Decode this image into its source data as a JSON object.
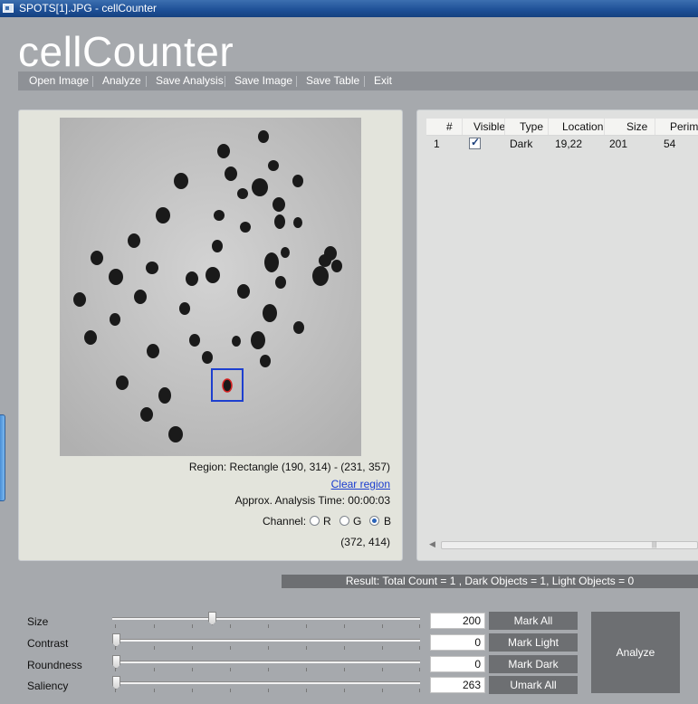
{
  "window": {
    "title": "SPOTS[1].JPG - cellCounter"
  },
  "app": {
    "title": "cellCounter"
  },
  "menu": [
    {
      "id": "open-image",
      "label": "Open Image"
    },
    {
      "id": "analyze",
      "label": "Analyze"
    },
    {
      "id": "save-analysis",
      "label": "Save Analysis"
    },
    {
      "id": "save-image",
      "label": "Save Image"
    },
    {
      "id": "save-table",
      "label": "Save Table"
    },
    {
      "id": "exit",
      "label": "Exit"
    }
  ],
  "image_panel": {
    "region_text": "Region: Rectangle (190, 314) - (231, 357)",
    "clear_region": "Clear region",
    "analysis_time": "Approx. Analysis Time: 00:00:03",
    "channel_label": "Channel:",
    "channels": [
      {
        "label": "R",
        "selected": false
      },
      {
        "label": "G",
        "selected": false
      },
      {
        "label": "B",
        "selected": true
      }
    ],
    "cursor_coords": "(372, 414)"
  },
  "table": {
    "columns": [
      "#",
      "Visible",
      "Type",
      "Location",
      "Size",
      "Perime"
    ],
    "rows": [
      {
        "num": "1",
        "visible": true,
        "type": "Dark",
        "location": "19,22",
        "size": "201",
        "perimeter": "54"
      }
    ]
  },
  "result": {
    "text": "Result: Total Count = 1 , Dark Objects = 1, Light Objects = 0"
  },
  "controls": {
    "sliders": [
      {
        "id": "size",
        "label": "Size",
        "value": "200",
        "level": 0.32
      },
      {
        "id": "contrast",
        "label": "Contrast",
        "value": "0",
        "level": 0.0
      },
      {
        "id": "roundness",
        "label": "Roundness",
        "value": "0",
        "level": 0.0
      },
      {
        "id": "saliency",
        "label": "Saliency",
        "value": "263",
        "level": 0.0
      }
    ],
    "buttons": {
      "mark_all": "Mark All",
      "mark_light": "Mark Light",
      "mark_dark": "Mark Dark",
      "unmark_all": "Umark All",
      "analyze": "Analyze"
    }
  },
  "colors": {
    "background": "#a6a9ad",
    "selection_box": "#1d3fcf",
    "marked_spot_outline": "#d82222",
    "button": "#6d6f72"
  }
}
